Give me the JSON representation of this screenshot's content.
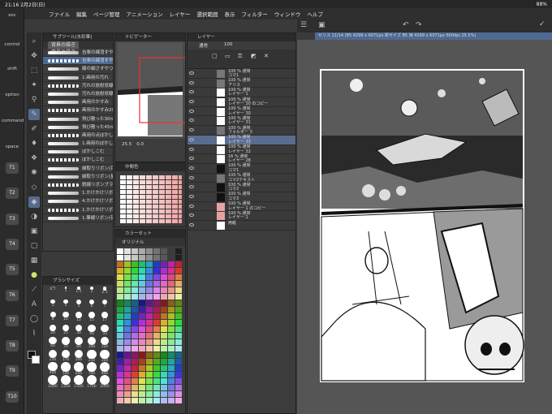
{
  "status": {
    "time": "21:16",
    "date": "2月2日(日)",
    "battery": "88%"
  },
  "menu": [
    "ファイル",
    "編集",
    "ページ管理",
    "アニメーション",
    "レイヤー",
    "選択範囲",
    "表示",
    "フィルター",
    "ウィンドウ",
    "ヘルプ"
  ],
  "leftdock": {
    "labels": [
      "esc",
      "control",
      "shift",
      "option",
      "command",
      "space"
    ],
    "keys": [
      "T1",
      "T2",
      "T3",
      "T4",
      "T5",
      "T6",
      "T7",
      "T8",
      "T9",
      "T10"
    ]
  },
  "subtool": {
    "title": "サブツール[水彩筆]",
    "tabs": [
      "背景の描き",
      "背景の描き"
    ],
    "brushes": [
      "吉楽の線消すやつ・調整用-小",
      "吉楽の線消すやつ・調整用-大",
      "線の細さすやつ",
      "1.画用の汚れ",
      "汚れの放射状線",
      "汚れの放射状線",
      "画用のかすみ",
      "画用のかすみ20mm",
      "飛び散った30mmカケアミ",
      "飛び散った45mm",
      "画用の点ぼかし",
      "1.画用のぼかし",
      "ぼかしこむ",
      "ぼかしこむ",
      "縁取りリボン(花)",
      "縁取りリボン(星)",
      "鋭線リボンブラシ",
      "1.かけかけリボンブラシ",
      "4.かけかけリボン(花火)",
      "1.かけかけリボンブラシ(花火)",
      "1.筆線リボン(花)"
    ]
  },
  "brushsize": {
    "title": "ブラシサイズ",
    "sizes": [
      "0.7",
      "1",
      "1.5",
      "2",
      "2.5",
      "3",
      "4",
      "5",
      "6",
      "7",
      "8",
      "10",
      "12",
      "15",
      "17",
      "20",
      "25",
      "30",
      "40",
      "50",
      "60",
      "70",
      "80",
      "100",
      "120",
      "150",
      "170",
      "200",
      "250",
      "300",
      "400",
      "500",
      "600",
      "700",
      "800",
      "1000",
      "1200",
      "1500",
      "1700",
      "2000"
    ]
  },
  "navigator": {
    "title": "ナビゲーター",
    "zoom": "25.5",
    "angle": "0.0"
  },
  "colorpanel": {
    "title": "中間色"
  },
  "colorset": {
    "title": "カラーセット",
    "set": "オリジナル"
  },
  "layers": {
    "title": "レイヤー",
    "blend": "通常",
    "opacity": "100",
    "items": [
      {
        "l1": "100 % 通常",
        "l2": "コマ1",
        "kind": "folder",
        "sel": false
      },
      {
        "l1": "100 % 通常",
        "l2": "アリス",
        "kind": "folder",
        "sel": false
      },
      {
        "l1": "100 % 通常",
        "l2": "レイヤー 1",
        "kind": "raster",
        "sel": false
      },
      {
        "l1": "100 % 通常",
        "l2": "レイヤー 30 のコピー",
        "kind": "raster",
        "sel": false
      },
      {
        "l1": "100 % 通常",
        "l2": "レイヤー 30",
        "kind": "raster",
        "sel": false
      },
      {
        "l1": "100 % 通常",
        "l2": "レイヤー 31",
        "kind": "raster",
        "sel": false
      },
      {
        "l1": "100 % 通常",
        "l2": "フォルダー 3",
        "kind": "folder",
        "sel": false
      },
      {
        "l1": "100 % 通常",
        "l2": "レイヤー 33",
        "kind": "raster",
        "sel": true
      },
      {
        "l1": "100 % 通常",
        "l2": "レイヤー 32",
        "kind": "raster",
        "sel": false
      },
      {
        "l1": "16 % 通常",
        "l2": "レイヤー 28",
        "kind": "raster",
        "sel": false
      },
      {
        "l1": "100 % 通常",
        "l2": "コマ1",
        "kind": "frame",
        "sel": false
      },
      {
        "l1": "100 % 通常",
        "l2": "コマ2テキスト",
        "kind": "folder",
        "sel": false
      },
      {
        "l1": "100 % 通常",
        "l2": "コマ2",
        "kind": "frame",
        "sel": false
      },
      {
        "l1": "100 % 通常",
        "l2": "コマ3",
        "kind": "frame",
        "sel": false
      },
      {
        "l1": "100 % 通常",
        "l2": "レイヤー 1 のコピー",
        "kind": "pink",
        "sel": false
      },
      {
        "l1": "100 % 通常",
        "l2": "レイヤー 1",
        "kind": "pink",
        "sel": false
      },
      {
        "l1": "",
        "l2": "用紙",
        "kind": "paper",
        "sel": false
      }
    ]
  },
  "canvas": {
    "tab": "セリス 11/14 (B5 4299 x 6071px 新サイズ B5 用 4299 x 6071px 600dpi 25.5%)"
  }
}
